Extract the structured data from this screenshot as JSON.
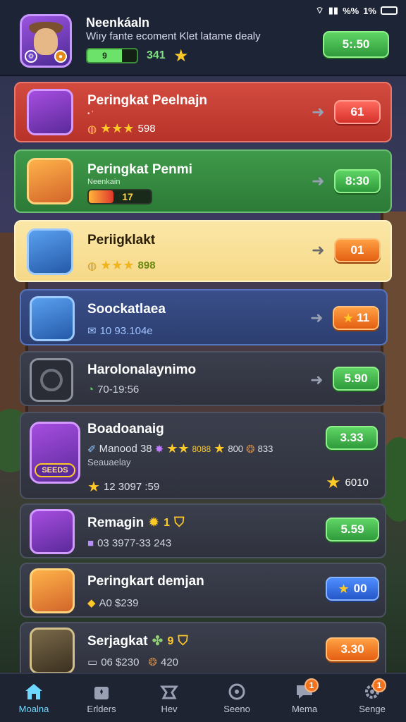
{
  "status": {
    "right_text": "%%",
    "battery_label": "1%"
  },
  "header": {
    "title": "Neenkáaln",
    "subtitle": "Wiıy fante ecoment Klet latame dealy",
    "xp_fill_label": "9",
    "xp_value": "341",
    "button": "5:.50"
  },
  "cards": [
    {
      "title": "Peringkat Peelnajn",
      "subline": "• '",
      "stat": "598",
      "button": "61"
    },
    {
      "title": "Peringkat Penmi",
      "subline": "Neenkain",
      "stat": "17",
      "button": "8:30"
    },
    {
      "title": "Periigklakt",
      "stat": "898",
      "button": "01"
    },
    {
      "title": "Soockatlaea",
      "stat": "10 93.104e",
      "button": "11"
    },
    {
      "title": "Harolonalaynimo",
      "stat": "70-19:56",
      "button": "5.90"
    },
    {
      "title": "Boadoanaig",
      "stat_a": "Manood 38",
      "stat_b": "8088",
      "stat_c": "800",
      "stat_d": "833",
      "subline": "Seauaelay",
      "stat2": "12 3097 :59",
      "button": "3.33",
      "reward": "6010",
      "icon_label": "SEEDS"
    },
    {
      "title": "Remagin",
      "title_badge": "1",
      "stat": "03 3977-33 243",
      "button": "5.59"
    },
    {
      "title": "Peringkart demjan",
      "stat": "A0 $239",
      "button": "00"
    },
    {
      "title": "Serjagkat",
      "title_badge": "9",
      "stat_a": "06 $230",
      "stat_b": "420",
      "button": "3.30"
    }
  ],
  "nav": [
    {
      "label": "Moalna",
      "active": true
    },
    {
      "label": "Erlders"
    },
    {
      "label": "Hev"
    },
    {
      "label": "Seeno"
    },
    {
      "label": "Mema",
      "badge": "1"
    },
    {
      "label": "Senge",
      "badge": "1"
    }
  ],
  "colors": {
    "accent": "#6dd9ff",
    "gold": "#ffc928",
    "green": "#5fd565"
  }
}
